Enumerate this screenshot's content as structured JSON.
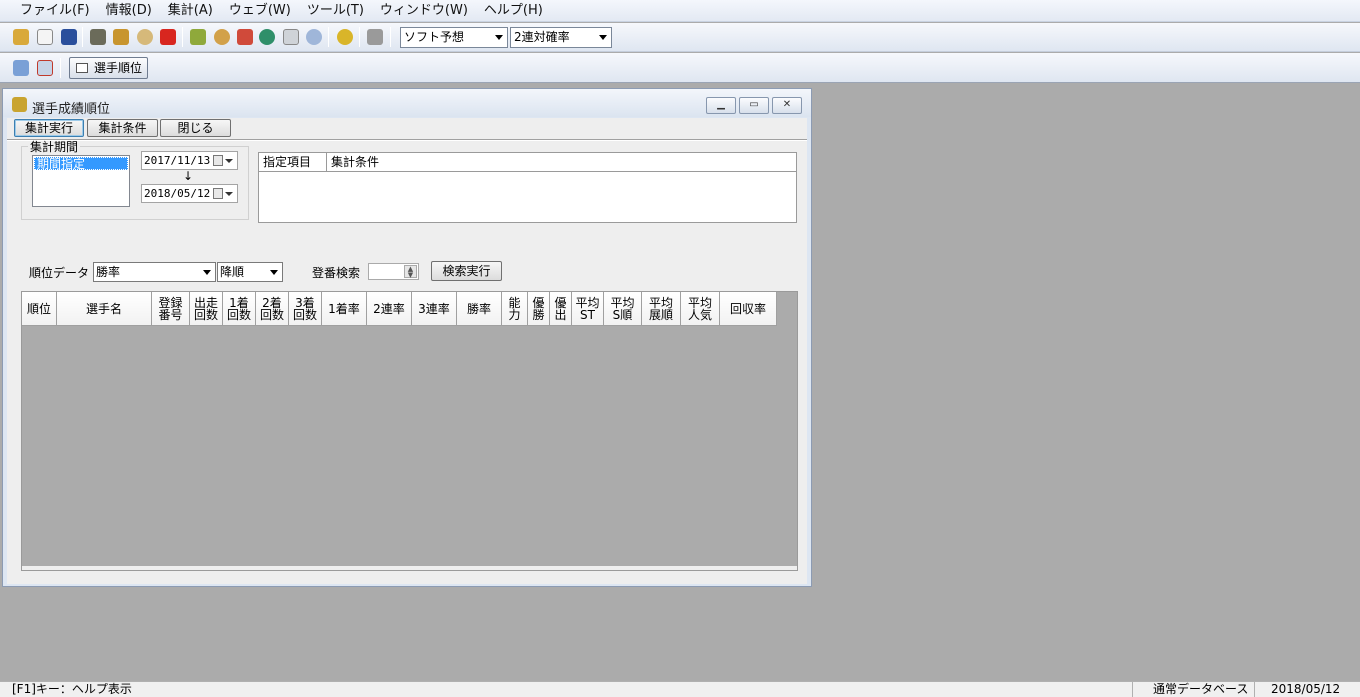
{
  "menu": [
    "ファイル(F)",
    "情報(D)",
    "集計(A)",
    "ウェブ(W)",
    "ツール(T)",
    "ウィンドウ(W)",
    "ヘルプ(H)"
  ],
  "toolbar": {
    "select1": "ソフト予想",
    "select2": "2連対確率",
    "tab_label": "選手順位"
  },
  "window": {
    "title": "選手成績順位",
    "buttons": {
      "run": "集計実行",
      "conditions": "集計条件",
      "close": "閉じる"
    }
  },
  "period": {
    "label": "集計期間",
    "list_selected": "期間指定",
    "from": "2017/11/13",
    "arrow": "↓",
    "to": "2018/05/12"
  },
  "conditions_grid": {
    "headers": [
      "指定項目",
      "集計条件"
    ]
  },
  "rank": {
    "label": "順位データ",
    "data_value": "勝率",
    "order_value": "降順",
    "search_label": "登番検索",
    "search_button": "検索実行"
  },
  "table": {
    "columns": [
      {
        "label": "順位"
      },
      {
        "label": "選手名"
      },
      {
        "label": "登録\n番号"
      },
      {
        "label": "出走\n回数"
      },
      {
        "label": "1着\n回数"
      },
      {
        "label": "2着\n回数"
      },
      {
        "label": "3着\n回数"
      },
      {
        "label": "1着率"
      },
      {
        "label": "2連率"
      },
      {
        "label": "3連率"
      },
      {
        "label": "勝率"
      },
      {
        "label": "能\n力"
      },
      {
        "label": "優\n勝"
      },
      {
        "label": "優\n出"
      },
      {
        "label": "平均\nST"
      },
      {
        "label": "平均\nS順"
      },
      {
        "label": "平均\n展順"
      },
      {
        "label": "平均\n人気"
      },
      {
        "label": "回収率"
      }
    ]
  },
  "status": {
    "help": "[F1]キー：ヘルプ表示",
    "db": "通常データベース",
    "date": "2018/05/12"
  }
}
